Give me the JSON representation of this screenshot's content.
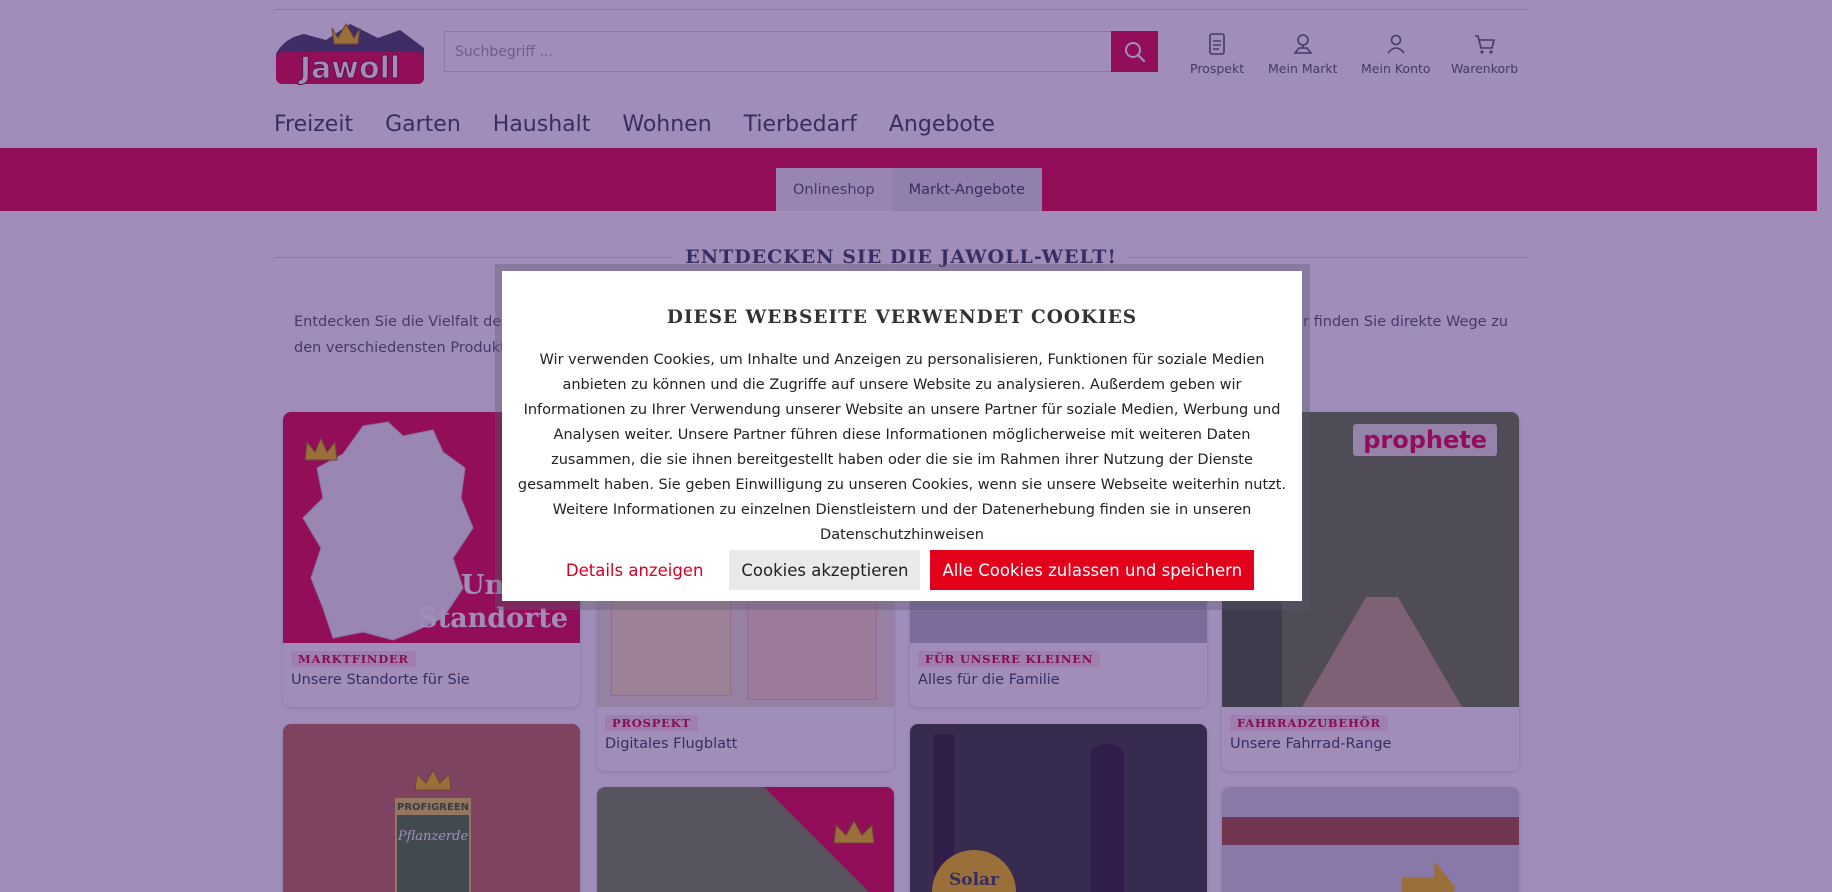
{
  "brand": {
    "logo_text": "Jawoll",
    "accent": "#e2003e"
  },
  "search": {
    "placeholder": "Suchbegriff ..."
  },
  "header_icons": [
    {
      "icon": "document-icon",
      "label": "Prospekt"
    },
    {
      "icon": "location-pin-icon",
      "label": "Mein Markt"
    },
    {
      "icon": "user-icon",
      "label": "Mein Konto"
    },
    {
      "icon": "cart-icon",
      "label": "Warenkorb"
    }
  ],
  "nav": [
    "Freizeit",
    "Garten",
    "Haushalt",
    "Wohnen",
    "Tierbedarf",
    "Angebote"
  ],
  "tabs": [
    {
      "label": "Onlineshop",
      "active": false
    },
    {
      "label": "Markt-Angebote",
      "active": true
    }
  ],
  "section": {
    "title": "ENTDECKEN SIE DIE JAWOLL-WELT!",
    "intro_left": "Entdecken Sie die Vielfalt der",
    "intro_right": "er finden Sie direkte Wege zu",
    "intro_line2": "den verschiedensten Produktk"
  },
  "tiles": [
    {
      "category": "MARKTFINDER",
      "caption": "Unsere Standorte für Sie",
      "image_text": [
        "Unsere",
        "Standorte"
      ]
    },
    {
      "category": "PROSPEKT",
      "caption": "Digitales Flugblatt"
    },
    {
      "category": "FÜR UNSERE KLEINEN",
      "caption": "Alles für die Familie"
    },
    {
      "category": "FAHRRADZUBEHÖR",
      "caption": "Unsere Fahrrad-Range",
      "image_text": "prophete"
    },
    {
      "image_text": "Pflanzerde",
      "brand": "PROFIGREEN"
    },
    {
      "image_text": ""
    },
    {
      "image_text": "Solar"
    },
    {
      "image_text": ""
    }
  ],
  "cookie_dialog": {
    "title": "DIESE WEBSEITE VERWENDET COOKIES",
    "text": "Wir verwenden Cookies, um Inhalte und Anzeigen zu personalisieren, Funktionen für soziale Medien anbieten zu können und die Zugriffe auf unsere Website zu analysieren. Außerdem geben wir Informationen zu Ihrer Verwendung unserer Website an unsere Partner für soziale Medien, Werbung und Analysen weiter. Unsere Partner führen diese Informationen möglicherweise mit weiteren Daten zusammen, die sie ihnen bereitgestellt haben oder die sie im Rahmen ihrer Nutzung der Dienste gesammelt haben. Sie geben Einwilligung zu unseren Cookies, wenn sie unsere Webseite weiterhin nutzt. Weitere Informationen zu einzelnen Dienstleistern und der Datenerhebung finden sie in unseren",
    "link": "Datenschutzhinweisen",
    "buttons": {
      "details": "Details anzeigen",
      "accept": "Cookies akzeptieren",
      "accept_all": "Alle Cookies zulassen und speichern"
    }
  }
}
